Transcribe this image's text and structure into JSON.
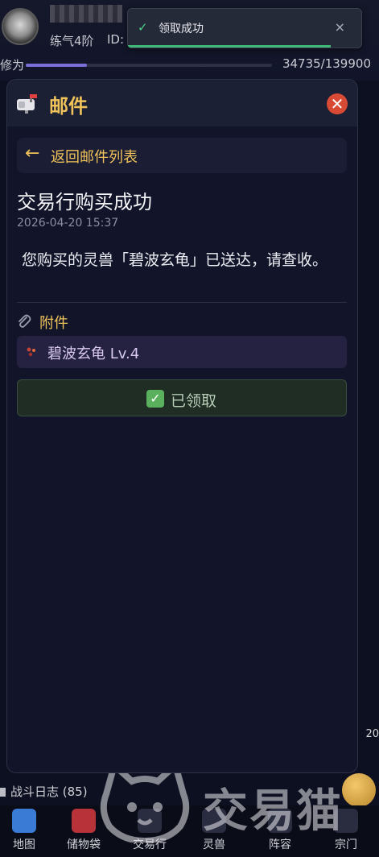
{
  "player": {
    "realm": "练气4阶",
    "id_label": "ID:",
    "exp_label": "修为",
    "exp_value": "34735/139900",
    "exp_progress": 0.248
  },
  "toast": {
    "icon": "check-icon",
    "message": "领取成功",
    "close_symbol": "×"
  },
  "mail_modal": {
    "title": "邮件",
    "close_symbol": "✕",
    "back_arrow": "←",
    "back_label": "返回邮件列表",
    "subject": "交易行购买成功",
    "date": "2026-04-20 15:37",
    "content": "您购买的灵兽「碧波玄龟」已送达，请查收。",
    "attachments_label": "附件",
    "attachment_item": "碧波玄龟 Lv.4",
    "claimed_label": "已领取",
    "claimed_icon": "✓",
    "colors": {
      "accent_gold": "#f0c35a",
      "close_red": "#d94a35",
      "claimed_green": "#5ab05c"
    }
  },
  "side": {
    "battle_log": "战斗日志 (85)",
    "badge": "20"
  },
  "bottom_nav": [
    {
      "label": "地图",
      "icon": "map-icon"
    },
    {
      "label": "储物袋",
      "icon": "bag-icon"
    },
    {
      "label": "交易行",
      "icon": "trade-icon"
    },
    {
      "label": "灵兽",
      "icon": "beast-icon"
    },
    {
      "label": "阵容",
      "icon": "formation-icon"
    },
    {
      "label": "宗门",
      "icon": "sect-icon"
    }
  ],
  "watermark": {
    "text": "交易猫"
  }
}
